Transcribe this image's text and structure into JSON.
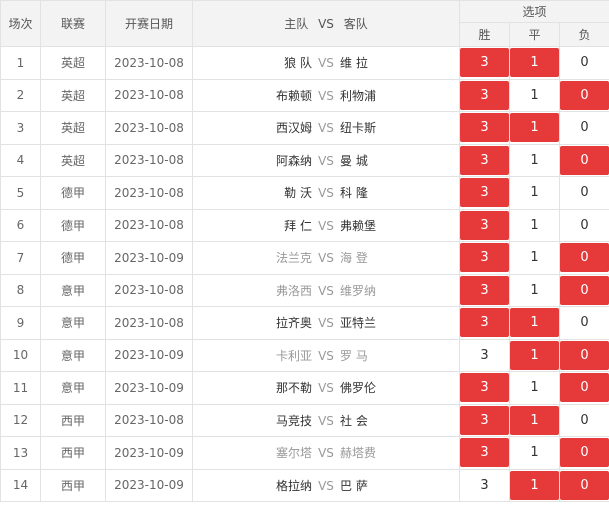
{
  "headers": {
    "index": "场次",
    "league": "联赛",
    "date": "开赛日期",
    "home": "主队",
    "vs": "VS",
    "away": "客队",
    "options": "选项",
    "win": "胜",
    "draw": "平",
    "lose": "负"
  },
  "colors": {
    "selected": "#e63a3a",
    "header_bg": "#f3f3f3",
    "border": "#e2e2e2",
    "muted_text": "#999999"
  },
  "rows": [
    {
      "index": "1",
      "league": "英超",
      "date": "2023-10-08",
      "home": "狼 队",
      "vs": "VS",
      "away": "维 拉",
      "muted": false,
      "win": "3",
      "draw": "1",
      "lose": "0",
      "selected": [
        "win",
        "draw"
      ]
    },
    {
      "index": "2",
      "league": "英超",
      "date": "2023-10-08",
      "home": "布赖顿",
      "vs": "VS",
      "away": "利物浦",
      "muted": false,
      "win": "3",
      "draw": "1",
      "lose": "0",
      "selected": [
        "win",
        "lose"
      ]
    },
    {
      "index": "3",
      "league": "英超",
      "date": "2023-10-08",
      "home": "西汉姆",
      "vs": "VS",
      "away": "纽卡斯",
      "muted": false,
      "win": "3",
      "draw": "1",
      "lose": "0",
      "selected": [
        "win",
        "draw"
      ]
    },
    {
      "index": "4",
      "league": "英超",
      "date": "2023-10-08",
      "home": "阿森纳",
      "vs": "VS",
      "away": "曼 城",
      "muted": false,
      "win": "3",
      "draw": "1",
      "lose": "0",
      "selected": [
        "win",
        "lose"
      ]
    },
    {
      "index": "5",
      "league": "德甲",
      "date": "2023-10-08",
      "home": "勒 沃",
      "vs": "VS",
      "away": "科 隆",
      "muted": false,
      "win": "3",
      "draw": "1",
      "lose": "0",
      "selected": [
        "win"
      ]
    },
    {
      "index": "6",
      "league": "德甲",
      "date": "2023-10-08",
      "home": "拜 仁",
      "vs": "VS",
      "away": "弗赖堡",
      "muted": false,
      "win": "3",
      "draw": "1",
      "lose": "0",
      "selected": [
        "win"
      ]
    },
    {
      "index": "7",
      "league": "德甲",
      "date": "2023-10-09",
      "home": "法兰克",
      "vs": "VS",
      "away": "海 登",
      "muted": true,
      "win": "3",
      "draw": "1",
      "lose": "0",
      "selected": [
        "win",
        "lose"
      ]
    },
    {
      "index": "8",
      "league": "意甲",
      "date": "2023-10-08",
      "home": "弗洛西",
      "vs": "VS",
      "away": "维罗纳",
      "muted": true,
      "win": "3",
      "draw": "1",
      "lose": "0",
      "selected": [
        "win",
        "lose"
      ]
    },
    {
      "index": "9",
      "league": "意甲",
      "date": "2023-10-08",
      "home": "拉齐奥",
      "vs": "VS",
      "away": "亚特兰",
      "muted": false,
      "win": "3",
      "draw": "1",
      "lose": "0",
      "selected": [
        "win",
        "draw"
      ]
    },
    {
      "index": "10",
      "league": "意甲",
      "date": "2023-10-09",
      "home": "卡利亚",
      "vs": "VS",
      "away": "罗 马",
      "muted": true,
      "win": "3",
      "draw": "1",
      "lose": "0",
      "selected": [
        "draw",
        "lose"
      ]
    },
    {
      "index": "11",
      "league": "意甲",
      "date": "2023-10-09",
      "home": "那不勒",
      "vs": "VS",
      "away": "佛罗伦",
      "muted": false,
      "win": "3",
      "draw": "1",
      "lose": "0",
      "selected": [
        "win",
        "lose"
      ]
    },
    {
      "index": "12",
      "league": "西甲",
      "date": "2023-10-08",
      "home": "马竞技",
      "vs": "VS",
      "away": "社 会",
      "muted": false,
      "win": "3",
      "draw": "1",
      "lose": "0",
      "selected": [
        "win",
        "draw"
      ]
    },
    {
      "index": "13",
      "league": "西甲",
      "date": "2023-10-09",
      "home": "塞尔塔",
      "vs": "VS",
      "away": "赫塔费",
      "muted": true,
      "win": "3",
      "draw": "1",
      "lose": "0",
      "selected": [
        "win",
        "lose"
      ]
    },
    {
      "index": "14",
      "league": "西甲",
      "date": "2023-10-09",
      "home": "格拉纳",
      "vs": "VS",
      "away": "巴 萨",
      "muted": false,
      "win": "3",
      "draw": "1",
      "lose": "0",
      "selected": [
        "draw",
        "lose"
      ]
    }
  ]
}
